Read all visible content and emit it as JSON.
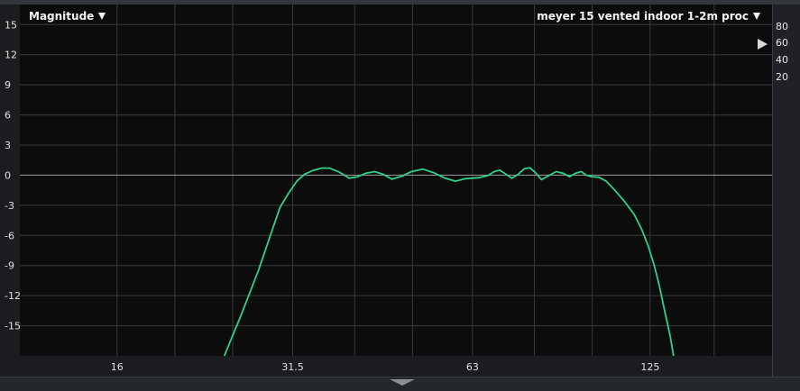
{
  "header": {
    "view_selector": "Magnitude",
    "trace_selector": "meyer 15 vented indoor 1-2m proc"
  },
  "coherence_scale": {
    "labels": [
      "80",
      "60",
      "40",
      "20"
    ]
  },
  "colors": {
    "trace": "#2fd08a",
    "background": "#0c0c0c",
    "grid": "#3a3a3a",
    "zero_line": "#9a9a9a"
  },
  "chart_data": {
    "type": "line",
    "x_scale": "log",
    "xlim": [
      11,
      200
    ],
    "ylim": [
      -18,
      17
    ],
    "x_tick_labels": [
      {
        "value": 16,
        "label": "16"
      },
      {
        "value": 31.5,
        "label": "31.5"
      },
      {
        "value": 63,
        "label": "63"
      },
      {
        "value": 125,
        "label": "125"
      }
    ],
    "x_minor_grid": [
      20,
      25,
      40,
      50,
      80,
      100,
      160
    ],
    "y_ticks": [
      15,
      12,
      9,
      6,
      3,
      0,
      -3,
      -6,
      -9,
      -12,
      -15
    ],
    "grid": true,
    "series": [
      {
        "points": [
          [
            24.2,
            -18
          ],
          [
            25.8,
            -14
          ],
          [
            27.6,
            -9.5
          ],
          [
            28.9,
            -6
          ],
          [
            30.0,
            -3.2
          ],
          [
            31.0,
            -1.8
          ],
          [
            32.0,
            -0.6
          ],
          [
            33.0,
            0.1
          ],
          [
            34.0,
            0.45
          ],
          [
            35.2,
            0.7
          ],
          [
            36.3,
            0.7
          ],
          [
            37.7,
            0.3
          ],
          [
            39.2,
            -0.3
          ],
          [
            40.5,
            -0.15
          ],
          [
            41.8,
            0.2
          ],
          [
            43.2,
            0.35
          ],
          [
            44.6,
            0.1
          ],
          [
            46.2,
            -0.4
          ],
          [
            48.0,
            -0.1
          ],
          [
            49.8,
            0.35
          ],
          [
            52.0,
            0.6
          ],
          [
            54.2,
            0.25
          ],
          [
            56.7,
            -0.3
          ],
          [
            59.0,
            -0.6
          ],
          [
            61.4,
            -0.35
          ],
          [
            64.5,
            -0.25
          ],
          [
            66.8,
            -0.05
          ],
          [
            68.5,
            0.35
          ],
          [
            70.0,
            0.5
          ],
          [
            71.7,
            0.1
          ],
          [
            73.3,
            -0.3
          ],
          [
            75.0,
            0.05
          ],
          [
            77.0,
            0.65
          ],
          [
            78.6,
            0.75
          ],
          [
            80.3,
            0.25
          ],
          [
            82.2,
            -0.45
          ],
          [
            84.5,
            -0.05
          ],
          [
            87.0,
            0.35
          ],
          [
            89.3,
            0.2
          ],
          [
            91.6,
            -0.15
          ],
          [
            93.8,
            0.2
          ],
          [
            95.8,
            0.35
          ],
          [
            97.7,
            0.0
          ],
          [
            99.7,
            -0.15
          ],
          [
            102.5,
            -0.2
          ],
          [
            105.5,
            -0.6
          ],
          [
            109.5,
            -1.6
          ],
          [
            113.5,
            -2.7
          ],
          [
            117.5,
            -3.9
          ],
          [
            121.0,
            -5.4
          ],
          [
            124.0,
            -7.0
          ],
          [
            127.0,
            -9.0
          ],
          [
            129.5,
            -11.0
          ],
          [
            132.5,
            -13.8
          ],
          [
            135.0,
            -16.0
          ],
          [
            136.8,
            -18
          ]
        ]
      }
    ]
  }
}
